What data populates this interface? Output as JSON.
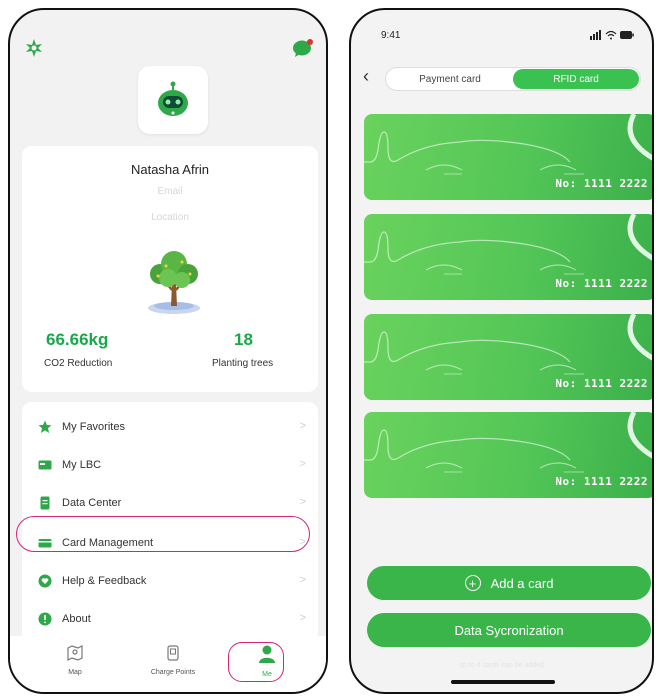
{
  "left": {
    "profile": {
      "name": "Natasha Afrin",
      "email": "Email",
      "location": "Location"
    },
    "stats": {
      "co2_value": "66.66kg",
      "co2_label": "CO2 Reduction",
      "trees_value": "18",
      "trees_label": "Planting trees"
    },
    "menu": [
      {
        "label": "My Favorites",
        "icon": "star-icon"
      },
      {
        "label": "My LBC",
        "icon": "card-icon"
      },
      {
        "label": "Data Center",
        "icon": "document-icon"
      },
      {
        "label": "Card Management",
        "icon": "wallet-icon"
      },
      {
        "label": "Help & Feedback",
        "icon": "heart-chat-icon"
      },
      {
        "label": "About",
        "icon": "info-icon"
      }
    ],
    "chevron": ">",
    "tabs": [
      {
        "label": "Map"
      },
      {
        "label": "Charge Points"
      },
      {
        "label": "Me"
      }
    ],
    "colors": {
      "accent": "#1aa84a",
      "highlight": "#d4257b"
    }
  },
  "right": {
    "status_time": "9:41",
    "segment": {
      "left": "Payment card",
      "right": "RFID card"
    },
    "cards": [
      {
        "number": "No: 1111 2222"
      },
      {
        "number": "No: 1111 2222"
      },
      {
        "number": "No: 1111 2222"
      },
      {
        "number": "No: 1111 2222"
      }
    ],
    "add_button": "Add a card",
    "sync_button": "Data Sycronization",
    "limit_note": "up to 4 cards can be added",
    "colors": {
      "button": "#39b54a",
      "card": "#53c657"
    }
  }
}
